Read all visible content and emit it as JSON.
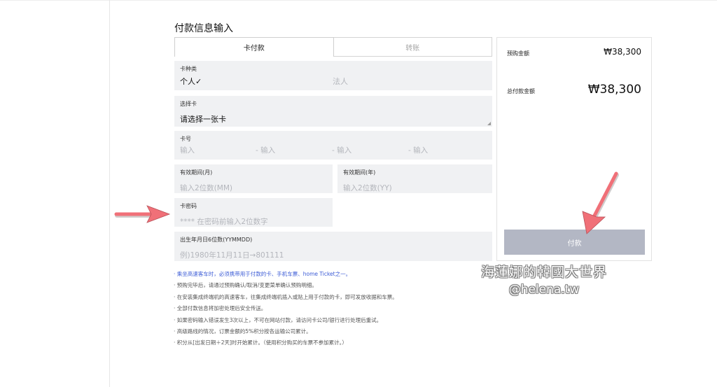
{
  "page": {
    "title": "付款信息输入"
  },
  "tabs": [
    {
      "label": "卡付款",
      "active": true
    },
    {
      "label": "转账",
      "active": false
    }
  ],
  "form": {
    "card_type": {
      "label": "卡种类",
      "option_personal": "个人✓",
      "option_corporate": "法人"
    },
    "select_card": {
      "label": "选择卡",
      "value": "请选择一张卡"
    },
    "card_number": {
      "label": "卡号",
      "ph1": "输入",
      "ph2": "- 输入",
      "ph3": "- 输入",
      "ph4": "- 输入"
    },
    "expiry_month": {
      "label": "有效期间(月)",
      "placeholder": "输入2位数(MM)"
    },
    "expiry_year": {
      "label": "有效期间(年)",
      "placeholder": "输入2位数(YY)"
    },
    "card_password": {
      "label": "卡密码",
      "placeholder": "**** 在密码前输入2位数字"
    },
    "birthdate": {
      "label": "出生年月日6位数(YYMMDD)",
      "placeholder": "例)1980年11月11日→801111"
    }
  },
  "notes": [
    "· 乘坐高速客车时，必须携带用于付款的卡、手机车票、home Ticket之一。",
    "· 预购完毕后，请通过预购确认/取消/变更菜单确认预购明细。",
    "· 在安装集成终端机的高速客车，往集成终端机插入或贴上用于付款的卡，即可发放收据和车票。",
    "· 全部付款信息将加密处理后安全传送。",
    "· 如果密码输入错误发生3次以上，不可在网站付款，请访问卡公司/银行进行处理后重试。",
    "· 高级路线的情况，订票金额的5%积分按各运输公司累计。",
    "· 积分从[出发日期＋2天]时开始累计。（使用积分购买的车票不参加累计。）"
  ],
  "summary": {
    "prepurchase_label": "预购金额",
    "prepurchase_amount": "₩38,300",
    "total_label": "总付款金额",
    "total_amount": "₩38,300",
    "pay_button": "付款"
  },
  "watermark": {
    "line1": "海蓮娜的韓國大世界",
    "line2": "@helena.tw"
  },
  "colors": {
    "field_bg": "#f0f1f3",
    "pay_button": "#b3b7c4",
    "note_highlight": "#3b5bd6",
    "annotation_arrow": "#f07078"
  }
}
